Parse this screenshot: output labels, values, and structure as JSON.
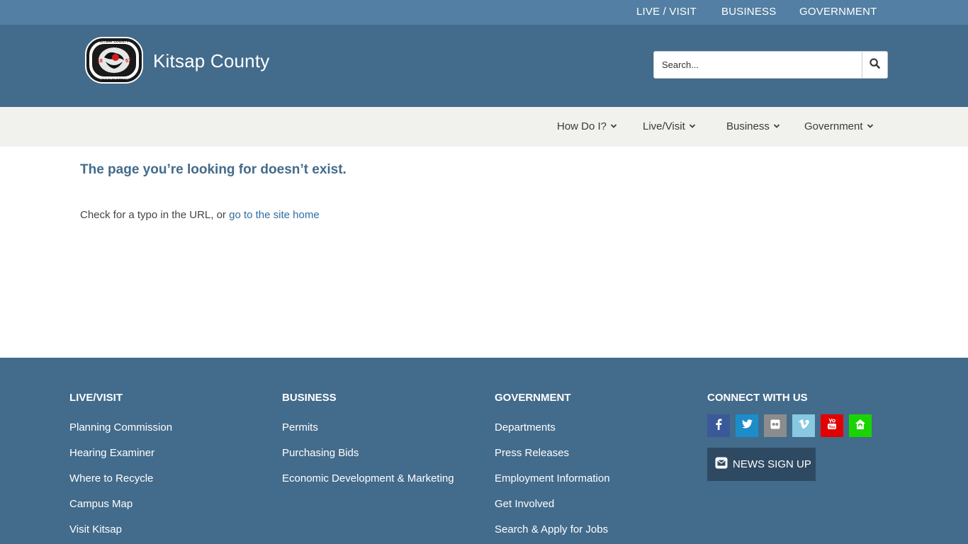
{
  "topbar": {
    "links": [
      "LIVE / VISIT",
      "BUSINESS",
      "GOVERNMENT"
    ]
  },
  "header": {
    "site_name": "Kitsap County",
    "logo": {
      "top_text": "KITSAP COUNTY",
      "bottom_text": "WASHINGTON",
      "year_left": "18",
      "year_right": "57"
    },
    "search": {
      "placeholder": "Search..."
    }
  },
  "nav": {
    "items": [
      "How Do I?",
      "Live/Visit",
      "Business",
      "Government"
    ]
  },
  "main": {
    "title": "The page you’re looking for doesn’t exist.",
    "text_prefix": "Check for a typo in the URL, or ",
    "link_text": "go to the site home"
  },
  "footer": {
    "columns": [
      {
        "heading": "LIVE/VISIT",
        "links": [
          "Planning Commission",
          "Hearing Examiner",
          "Where to Recycle",
          "Campus Map",
          "Visit Kitsap"
        ]
      },
      {
        "heading": "BUSINESS",
        "links": [
          "Permits",
          "Purchasing Bids",
          "Economic Development & Marketing"
        ]
      },
      {
        "heading": "GOVERNMENT",
        "links": [
          "Departments",
          "Press Releases",
          "Employment Information",
          "Get Involved",
          "Search & Apply for Jobs"
        ]
      }
    ],
    "connect": {
      "heading": "CONNECT WITH US",
      "social": [
        {
          "name": "facebook-icon",
          "color": "#3b5998"
        },
        {
          "name": "twitter-icon",
          "color": "#1d8dc9"
        },
        {
          "name": "flickr-icon",
          "color": "#8c8c8c"
        },
        {
          "name": "vimeo-icon",
          "color": "#86c9e0"
        },
        {
          "name": "youtube-icon",
          "color": "#e20000"
        },
        {
          "name": "nextdoor-icon",
          "color": "#19d400"
        }
      ],
      "news_label": "NEWS SIGN UP"
    }
  },
  "colors": {
    "topbar": "#527fa3",
    "header": "#436b8b",
    "nav": "#f1f1ee",
    "footer": "#436b8b",
    "link": "#2f6da3"
  }
}
